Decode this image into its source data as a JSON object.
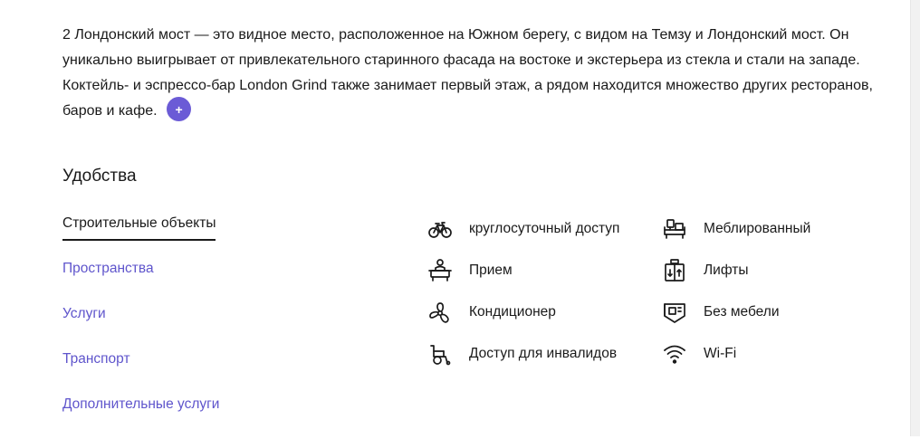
{
  "description": {
    "text": "2 Лондонский мост — это видное место, расположенное на Южном берегу, с видом на Темзу и Лондонский мост. Он уникально выигрывает от привлекательного старинного фасада на востоке и экстерьера из стекла и стали на западе. Коктейль- и эспрессо-бар London Grind также занимает первый этаж, а рядом находится множество других ресторанов, баров и кафе.",
    "expand_label": "+"
  },
  "amenities_section": {
    "title": "Удобства",
    "tabs": [
      {
        "label": "Строительные объекты",
        "active": true
      },
      {
        "label": "Пространства",
        "active": false
      },
      {
        "label": "Услуги",
        "active": false
      },
      {
        "label": "Транспорт",
        "active": false
      },
      {
        "label": "Дополнительные услуги",
        "active": false
      }
    ],
    "amenities_col1": [
      {
        "icon": "bicycle-icon",
        "label": "круглосуточный доступ"
      },
      {
        "icon": "reception-icon",
        "label": "Прием"
      },
      {
        "icon": "fan-icon",
        "label": "Кондиционер"
      },
      {
        "icon": "wheelchair-icon",
        "label": "Доступ для инвалидов"
      }
    ],
    "amenities_col2": [
      {
        "icon": "furniture-icon",
        "label": "Меблированный"
      },
      {
        "icon": "elevator-icon",
        "label": "Лифты"
      },
      {
        "icon": "empty-room-icon",
        "label": "Без мебели"
      },
      {
        "icon": "wifi-icon",
        "label": "Wi-Fi"
      }
    ]
  },
  "colors": {
    "accent": "#6b5bd6",
    "link": "#5f55cc",
    "text": "#1a1a1a"
  }
}
